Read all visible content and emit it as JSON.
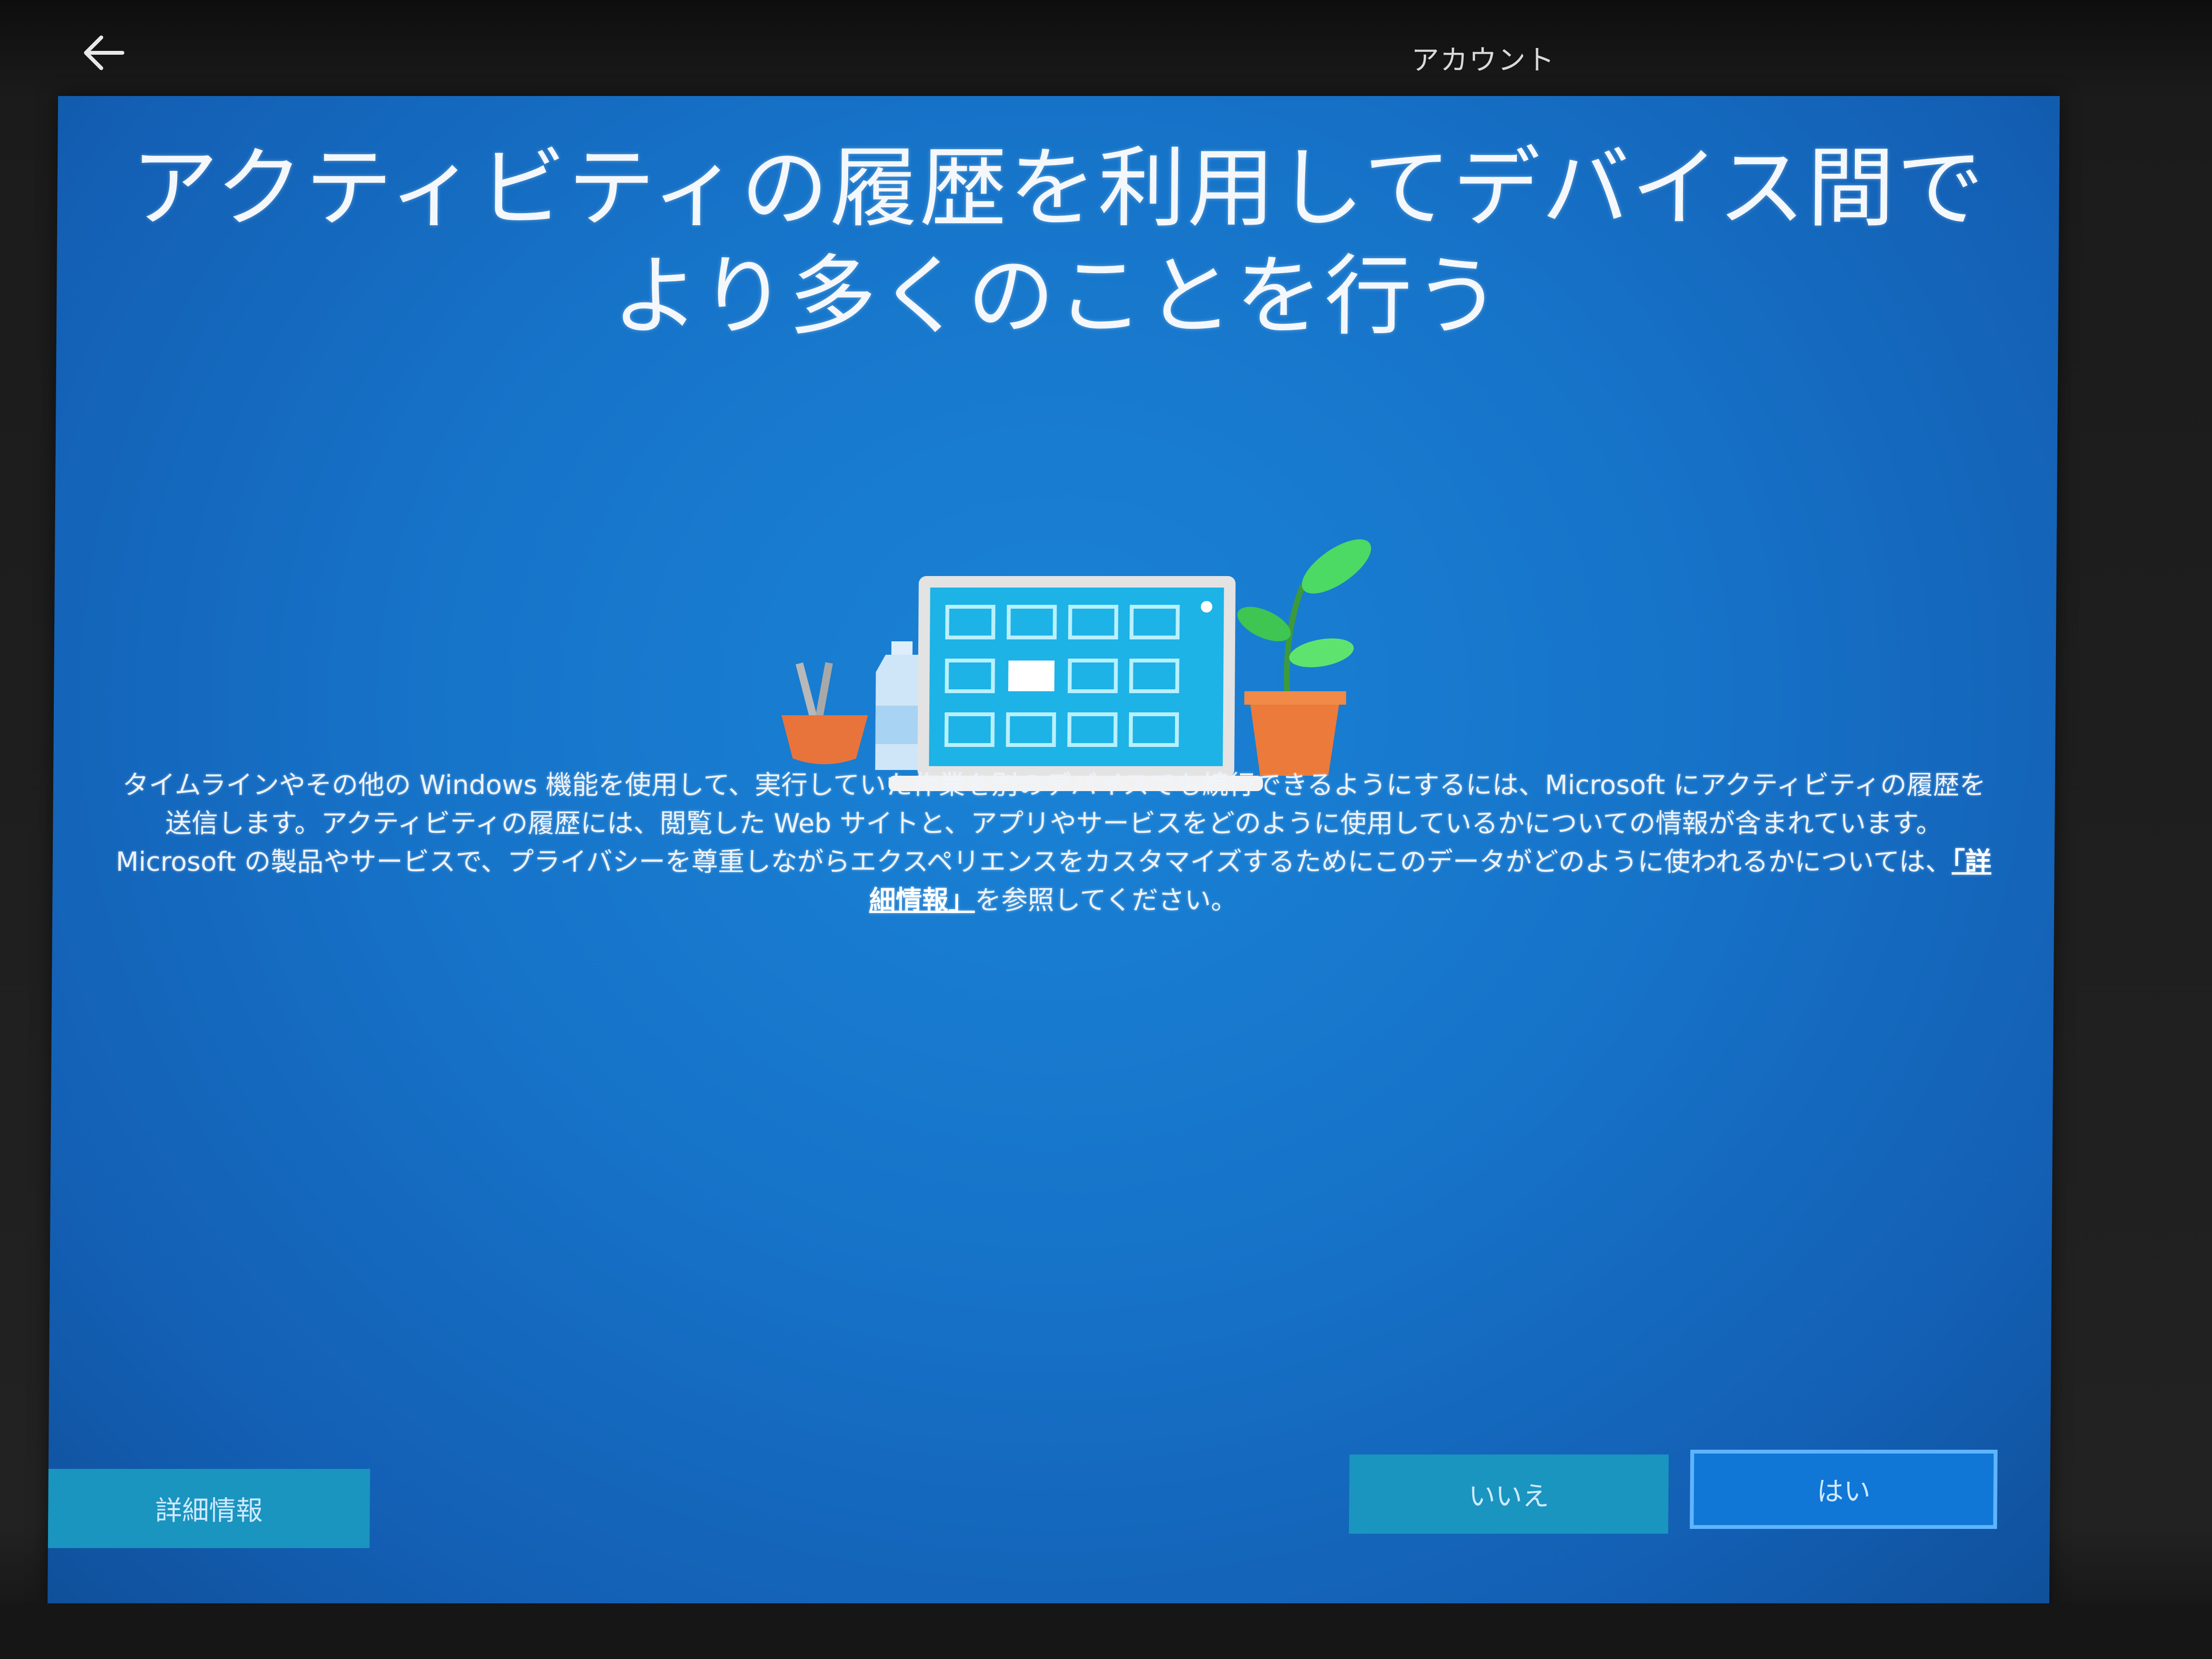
{
  "header": {
    "back_icon": "arrow-left-icon",
    "step_label": "アカウント"
  },
  "main": {
    "title": "アクティビティの履歴を利用してデバイス間でより多くのことを行う",
    "illustration_icon": "laptop-timeline-illustration",
    "description_before_link": "タイムラインやその他の Windows 機能を使用して、実行していた作業を別のデバイスでも続行できるようにするには、Microsoft にアクティビティの履歴を送信します。アクティビティの履歴には、閲覧した Web サイトと、アプリやサービスをどのように使用しているかについての情報が含まれています。Microsoft の製品やサービスで、プライバシーを尊重しながらエクスペリエンスをカスタマイズするためにこのデータがどのように使われるかについては、",
    "description_link": "「詳細情報」",
    "description_after_link": "を参照してください。"
  },
  "footer": {
    "learn_more_label": "詳細情報",
    "decline_label": "いいえ",
    "accept_label": "はい"
  },
  "colors": {
    "panel_blue": "#1673c8",
    "button_teal": "#1a95bf",
    "button_primary": "#1077d6"
  }
}
